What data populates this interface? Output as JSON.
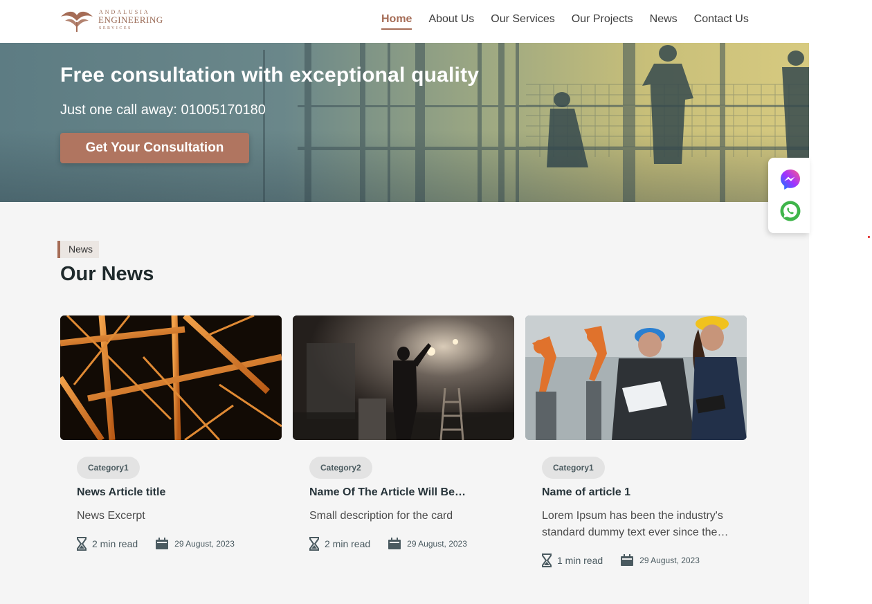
{
  "brand": {
    "line1": "ANDALUSIA",
    "line2": "ENGINEERING",
    "line3": "SERVICES"
  },
  "nav": [
    {
      "label": "Home",
      "active": true
    },
    {
      "label": "About Us",
      "active": false
    },
    {
      "label": "Our Services",
      "active": false
    },
    {
      "label": "Our Projects",
      "active": false
    },
    {
      "label": "News",
      "active": false
    },
    {
      "label": "Contact Us",
      "active": false
    }
  ],
  "hero": {
    "title": "Free consultation with exceptional quality",
    "subtitle": "Just one call away: 01005170180",
    "cta": "Get Your Consultation"
  },
  "social": [
    "messenger-icon",
    "whatsapp-icon"
  ],
  "news": {
    "tag": "News",
    "title": "Our News",
    "cards": [
      {
        "category": "Category1",
        "title": "News Article title",
        "excerpt": "News Excerpt",
        "read": "2 min read",
        "date": "29 August, 2023"
      },
      {
        "category": "Category2",
        "title": "Name Of The Article Will Be…",
        "excerpt": "Small description for the card",
        "read": "2 min read",
        "date": "29 August, 2023"
      },
      {
        "category": "Category1",
        "title": "Name of article 1",
        "excerpt": "Lorem Ipsum has been the industry's standard dummy text ever since the…",
        "read": "1 min read",
        "date": "29 August, 2023"
      }
    ]
  },
  "colors": {
    "accent": "#a56c56",
    "button": "#b07560",
    "background": "#f5f5f5"
  }
}
